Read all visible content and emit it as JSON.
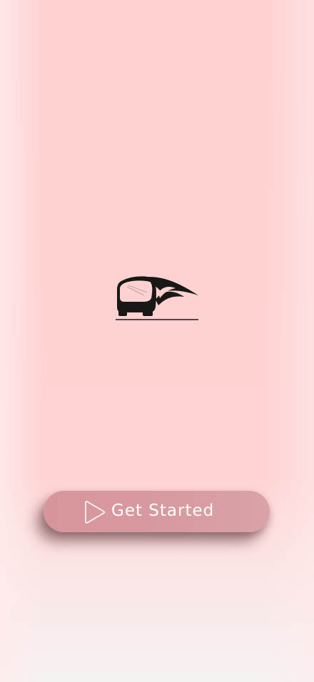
{
  "app": {
    "logo_icon": "bus-logo-icon"
  },
  "cta": {
    "label": "Get Started",
    "icon": "play-icon"
  },
  "colors": {
    "background": "#ffd1d1",
    "button": "#d7969c",
    "button_text": "#ffffff",
    "logo": "#1a1717"
  }
}
